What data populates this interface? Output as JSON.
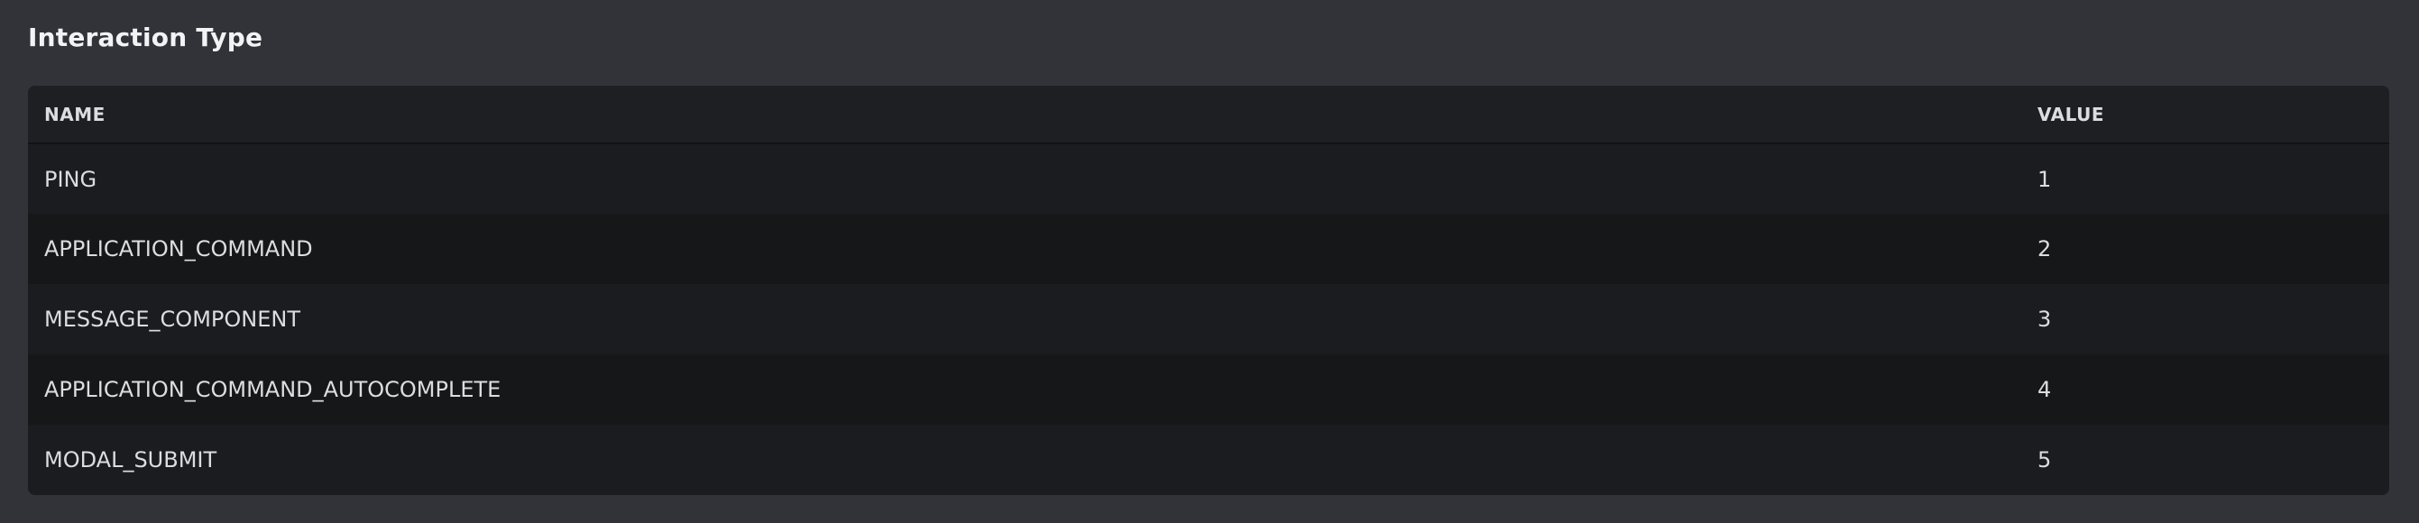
{
  "section": {
    "title": "Interaction Type"
  },
  "table": {
    "columns": [
      "NAME",
      "VALUE"
    ],
    "rows": [
      {
        "name": "PING",
        "value": "1"
      },
      {
        "name": "APPLICATION_COMMAND",
        "value": "2"
      },
      {
        "name": "MESSAGE_COMPONENT",
        "value": "3"
      },
      {
        "name": "APPLICATION_COMMAND_AUTOCOMPLETE",
        "value": "4"
      },
      {
        "name": "MODAL_SUBMIT",
        "value": "5"
      }
    ]
  },
  "colors": {
    "page_background": "#313338",
    "table_header_background": "#1e1f22",
    "row_background_odd": "#1b1c1f",
    "row_background_even": "#161719",
    "title_text": "#f2f3f5",
    "body_text": "#dbdee1"
  }
}
